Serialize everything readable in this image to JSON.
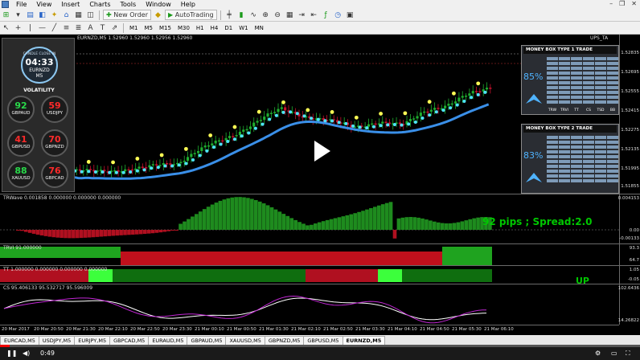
{
  "menu": [
    "File",
    "View",
    "Insert",
    "Charts",
    "Tools",
    "Window",
    "Help"
  ],
  "toolbar": {
    "new_order": "New Order",
    "autotrading": "AutoTrading",
    "timeframes": [
      "M1",
      "M5",
      "M15",
      "M30",
      "H1",
      "H4",
      "D1",
      "W1",
      "MN"
    ]
  },
  "chart": {
    "symbol_label": "EURNZD,M5 1.52960 1.52960 1.52956 1.52960",
    "right_label": "UPS_TA",
    "price_ticks": [
      "1.52835",
      "1.52695",
      "1.52555",
      "1.52415",
      "1.52275",
      "1.52135",
      "1.51995",
      "1.51855"
    ]
  },
  "infobox": {
    "candle_label": "CANDLE CLOSE IN",
    "time": "04:33",
    "pair": "EURNZD",
    "tf": "M5",
    "volatility_label": "VOLATILITY",
    "pairs": [
      {
        "value": "92",
        "name": "GBPAUD",
        "color": "#29d94a"
      },
      {
        "value": "59",
        "name": "USDJPY",
        "color": "#ff2a2a"
      },
      {
        "value": "41",
        "name": "GBPUSD",
        "color": "#ff2a2a"
      },
      {
        "value": "70",
        "name": "GBPNZD",
        "color": "#ff2a2a"
      },
      {
        "value": "88",
        "name": "XAUUSD",
        "color": "#29d94a"
      },
      {
        "value": "76",
        "name": "GBPCAD",
        "color": "#ff2a2a"
      }
    ]
  },
  "moneybox1": {
    "title": "MONEY BOX TYPE 1 TRADE",
    "percent": "85%",
    "columns": [
      "TRW",
      "TRVI",
      "TT",
      "CS",
      "TSD",
      "BB"
    ]
  },
  "moneybox2": {
    "title": "MONEY BOX TYPE 2 TRADE",
    "percent": "83%"
  },
  "indicators": {
    "trwave_label": "TRWave 0.001858 0.000000 0.000000 0.000000",
    "trwave_ticks": [
      "0.004153",
      "0.00",
      "-0.00133"
    ],
    "trvi_label": "TRVI 91.000000",
    "trvi_ticks": [
      "93.3",
      "64.7"
    ],
    "tt_label": "TT 1.000000 0.000000 0.000000 0.000000",
    "tt_ticks": [
      "1.05",
      "-0.05"
    ],
    "cs_label": "CS 95.406133 95.532717 95.596009",
    "cs_ticks": [
      "102.6436",
      "14.26822"
    ]
  },
  "overlay": {
    "pips_text": "92 pips ; Spread:2.0",
    "signal": "UP"
  },
  "xaxis": [
    "20 Mar 2017",
    "20 Mar 20:50",
    "20 Mar 21:30",
    "20 Mar 22:10",
    "20 Mar 22:50",
    "20 Mar 23:30",
    "21 Mar 00:10",
    "21 Mar 00:50",
    "21 Mar 01:30",
    "21 Mar 02:10",
    "21 Mar 02:50",
    "21 Mar 03:30",
    "21 Mar 04:10",
    "21 Mar 04:50",
    "21 Mar 05:30",
    "21 Mar 06:10"
  ],
  "tabs": [
    "EURCAD,M5",
    "USDJPY,M5",
    "EURJPY,M5",
    "GBPCAD,M5",
    "EURAUD,M5",
    "GBPAUD,M5",
    "XAUUSD,M5",
    "GBPNZD,M5",
    "GBPUSD,M5",
    "EURNZD,M5"
  ],
  "active_tab": "EURNZD,M5",
  "video": {
    "time": "0:49",
    "progress": 0.015
  }
}
